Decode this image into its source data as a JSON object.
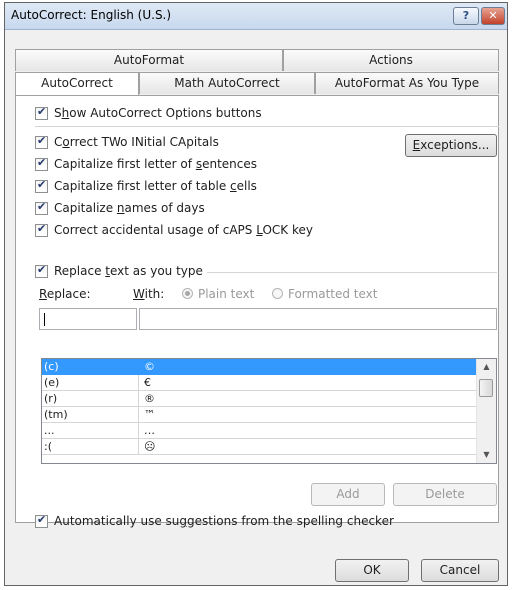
{
  "window": {
    "title": "AutoCorrect: English (U.S.)",
    "help_label": "?",
    "close_label": "✕"
  },
  "tabs": {
    "row1": [
      "AutoFormat",
      "Actions"
    ],
    "row2": [
      "AutoCorrect",
      "Math AutoCorrect",
      "AutoFormat As You Type"
    ],
    "active": "AutoCorrect"
  },
  "options": {
    "show_buttons": {
      "pre": "S",
      "ul": "h",
      "post": "ow AutoCorrect Options buttons",
      "checked": true
    },
    "items": [
      {
        "pre": "C",
        "ul": "o",
        "post": "rrect TWo INitial CApitals",
        "checked": true
      },
      {
        "pre": "Capitalize first letter of ",
        "ul": "s",
        "post": "entences",
        "checked": true
      },
      {
        "pre": "Capitalize first letter of table ",
        "ul": "c",
        "post": "ells",
        "checked": true
      },
      {
        "pre": "Capitalize ",
        "ul": "n",
        "post": "ames of days",
        "checked": true
      },
      {
        "pre": "Correct accidental usage of cAPS ",
        "ul": "L",
        "post": "OCK key",
        "checked": true
      }
    ],
    "exceptions_button": {
      "ul": "E",
      "post": "xceptions..."
    }
  },
  "replace_section": {
    "checkbox": {
      "pre": "Replace ",
      "ul": "t",
      "post": "ext as you type",
      "checked": true
    },
    "replace_label": {
      "pre": "",
      "ul": "R",
      "post": "eplace:"
    },
    "with_label": {
      "pre": "",
      "ul": "W",
      "post": "ith:"
    },
    "plain_text": "Plain text",
    "formatted_text": "Formatted text",
    "replace_value": "",
    "with_value": ""
  },
  "entries": [
    {
      "replace": "(c)",
      "with": "©",
      "selected": true
    },
    {
      "replace": "(e)",
      "with": "€",
      "selected": false
    },
    {
      "replace": "(r)",
      "with": "®",
      "selected": false
    },
    {
      "replace": "(tm)",
      "with": "™",
      "selected": false
    },
    {
      "replace": "...",
      "with": "…",
      "selected": false
    },
    {
      "replace": ":(",
      "with": "☹",
      "selected": false
    }
  ],
  "list_buttons": {
    "add": "Add",
    "delete": "Delete"
  },
  "spelling_checkbox": {
    "pre": "Automatically use su",
    "ul": "g",
    "post": "gestions from the spelling checker",
    "checked": true
  },
  "footer": {
    "ok": "OK",
    "cancel": "Cancel"
  },
  "colors": {
    "selection": "#3399ff",
    "title_gradient_top": "#dfe9f5",
    "close_red": "#c2422b"
  }
}
